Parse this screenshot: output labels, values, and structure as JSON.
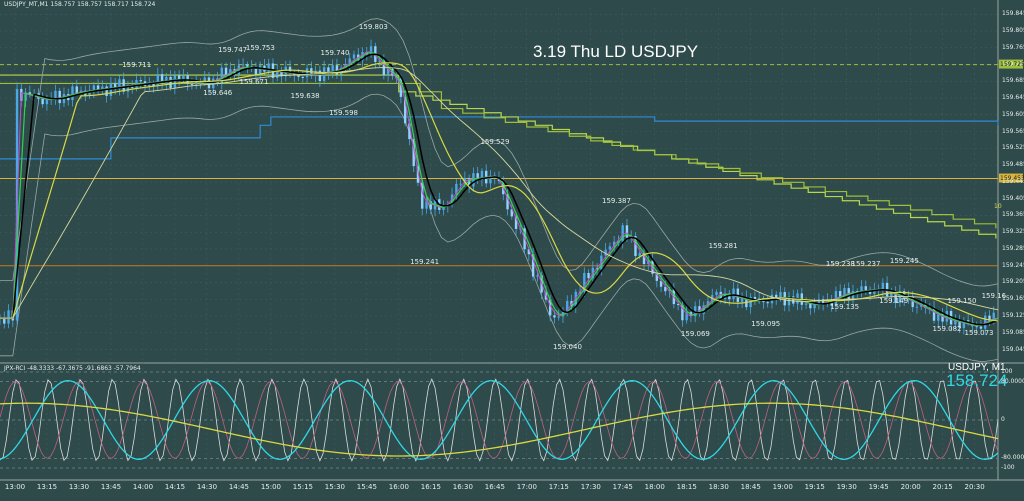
{
  "window": {
    "header_text": "USDJPY_MT,M1  158.757 158.757 158.717 158.724",
    "title_annotation": "3.19 Thu LD USDJPY",
    "symbol_label": "USDJPY, M1",
    "last_price": "158.724",
    "indicator_header": "JPX-RCI -48.3333 -67.3675 -91.6863 -57.7964",
    "small_tag": "10"
  },
  "colors": {
    "background": "#2e4a4a",
    "grid": "#3f5d5d",
    "candle_up": "#4aa8e6",
    "candle_down": "#8fd3ff",
    "ma_black": "#000000",
    "ma_green": "#32d24a",
    "ma_yellow": "#d9d943",
    "ma_magenta": "#c04fd0",
    "bollinger": "#9aa6a6",
    "step_blue": "#2f8cd6",
    "step_green": "#b7d84a",
    "hline_orange": "#c8781e",
    "hline_yellow": "#d9b43a",
    "rci_cyan": "#2fd8e6",
    "rci_white": "#dcdcdc",
    "rci_pink": "#c06080",
    "rci_yellow": "#d9d943"
  },
  "chart_data": {
    "type": "candlestick",
    "title": "3.19 Thu LD USDJPY",
    "symbol": "USDJPY",
    "timeframe": "M1",
    "ylim": [
      159.02,
      159.86
    ],
    "price_ticks": [
      "159.845",
      "159.805",
      "159.765",
      "159.725",
      "159.685",
      "159.645",
      "159.605",
      "159.565",
      "159.525",
      "159.485",
      "159.445",
      "159.405",
      "159.365",
      "159.325",
      "159.285",
      "159.245",
      "159.205",
      "159.165",
      "159.125",
      "159.085",
      "159.045"
    ],
    "time_labels": [
      "13:00",
      "13:15",
      "13:30",
      "13:45",
      "14:00",
      "14:15",
      "14:30",
      "14:45",
      "15:00",
      "15:15",
      "15:30",
      "15:45",
      "16:00",
      "16:15",
      "16:30",
      "16:45",
      "17:00",
      "17:15",
      "17:30",
      "17:45",
      "18:00",
      "18:15",
      "18:30",
      "18:45",
      "19:00",
      "19:15",
      "19:30",
      "19:45",
      "20:00",
      "20:15",
      "20:30"
    ],
    "close_path": [
      [
        "13:00",
        159.66
      ],
      [
        "13:15",
        159.64
      ],
      [
        "13:30",
        159.66
      ],
      [
        "13:45",
        159.67
      ],
      [
        "14:00",
        159.68
      ],
      [
        "14:15",
        159.69
      ],
      [
        "14:30",
        159.68
      ],
      [
        "14:45",
        159.72
      ],
      [
        "15:00",
        159.71
      ],
      [
        "15:15",
        159.7
      ],
      [
        "15:30",
        159.71
      ],
      [
        "15:45",
        159.76
      ],
      [
        "16:00",
        159.68
      ],
      [
        "16:10",
        159.4
      ],
      [
        "16:20",
        159.38
      ],
      [
        "16:30",
        159.45
      ],
      [
        "16:45",
        159.46
      ],
      [
        "17:00",
        159.28
      ],
      [
        "17:10",
        159.14
      ],
      [
        "17:15",
        159.12
      ],
      [
        "17:30",
        159.23
      ],
      [
        "17:45",
        159.33
      ],
      [
        "18:00",
        159.22
      ],
      [
        "18:15",
        159.12
      ],
      [
        "18:30",
        159.18
      ],
      [
        "18:45",
        159.16
      ],
      [
        "19:00",
        159.17
      ],
      [
        "19:15",
        159.15
      ],
      [
        "19:30",
        159.18
      ],
      [
        "19:45",
        159.19
      ],
      [
        "20:00",
        159.16
      ],
      [
        "20:15",
        159.12
      ],
      [
        "20:30",
        159.1
      ],
      [
        "20:38",
        159.12
      ]
    ],
    "price_annotations": [
      {
        "time": "13:55",
        "price": 159.711,
        "text": "159.711"
      },
      {
        "time": "14:40",
        "price": 159.747,
        "text": "159.747"
      },
      {
        "time": "14:53",
        "price": 159.753,
        "text": "159.753"
      },
      {
        "time": "15:28",
        "price": 159.74,
        "text": "159.740"
      },
      {
        "time": "15:46",
        "price": 159.803,
        "text": "159.803"
      },
      {
        "time": "14:33",
        "price": 159.646,
        "text": "159.646"
      },
      {
        "time": "14:50",
        "price": 159.671,
        "text": "159.671"
      },
      {
        "time": "15:14",
        "price": 159.638,
        "text": "159.638"
      },
      {
        "time": "15:32",
        "price": 159.598,
        "text": "159.598"
      },
      {
        "time": "16:43",
        "price": 159.529,
        "text": "159.529"
      },
      {
        "time": "16:10",
        "price": 159.241,
        "text": "159.241"
      },
      {
        "time": "17:40",
        "price": 159.387,
        "text": "159.387"
      },
      {
        "time": "18:30",
        "price": 159.281,
        "text": "159.281"
      },
      {
        "time": "17:17",
        "price": 159.04,
        "text": "159.040"
      },
      {
        "time": "18:17",
        "price": 159.069,
        "text": "159.069"
      },
      {
        "time": "18:50",
        "price": 159.095,
        "text": "159.095"
      },
      {
        "time": "19:25",
        "price": 159.238,
        "text": "159.238"
      },
      {
        "time": "19:37",
        "price": 159.237,
        "text": "159.237"
      },
      {
        "time": "19:55",
        "price": 159.245,
        "text": "159.245"
      },
      {
        "time": "19:27",
        "price": 159.135,
        "text": "159.135"
      },
      {
        "time": "19:50",
        "price": 159.149,
        "text": "159.149"
      },
      {
        "time": "20:22",
        "price": 159.15,
        "text": "159.150"
      },
      {
        "time": "20:15",
        "price": 159.082,
        "text": "159.082"
      },
      {
        "time": "20:30",
        "price": 159.073,
        "text": "159.073"
      },
      {
        "time": "20:38",
        "price": 159.16,
        "text": "159.16"
      }
    ],
    "horizontal_lines": [
      {
        "price": 159.725,
        "color": "#9fbf3a",
        "dashed": true,
        "tag": "159.725"
      },
      {
        "price": 159.453,
        "color": "#d9b43a",
        "dashed": false,
        "tag": "159.453"
      },
      {
        "price": 159.245,
        "color": "#c8781e",
        "dashed": false,
        "tag": ""
      }
    ],
    "indicator": {
      "name": "JPX-RCI",
      "values": [
        -48.3333,
        -67.3675,
        -91.6863,
        -57.7964
      ],
      "levels": [
        100,
        80,
        0,
        -80,
        -100
      ],
      "level_labels": [
        "100",
        "80.0000",
        "0",
        "-80.0000",
        "-100"
      ]
    }
  }
}
